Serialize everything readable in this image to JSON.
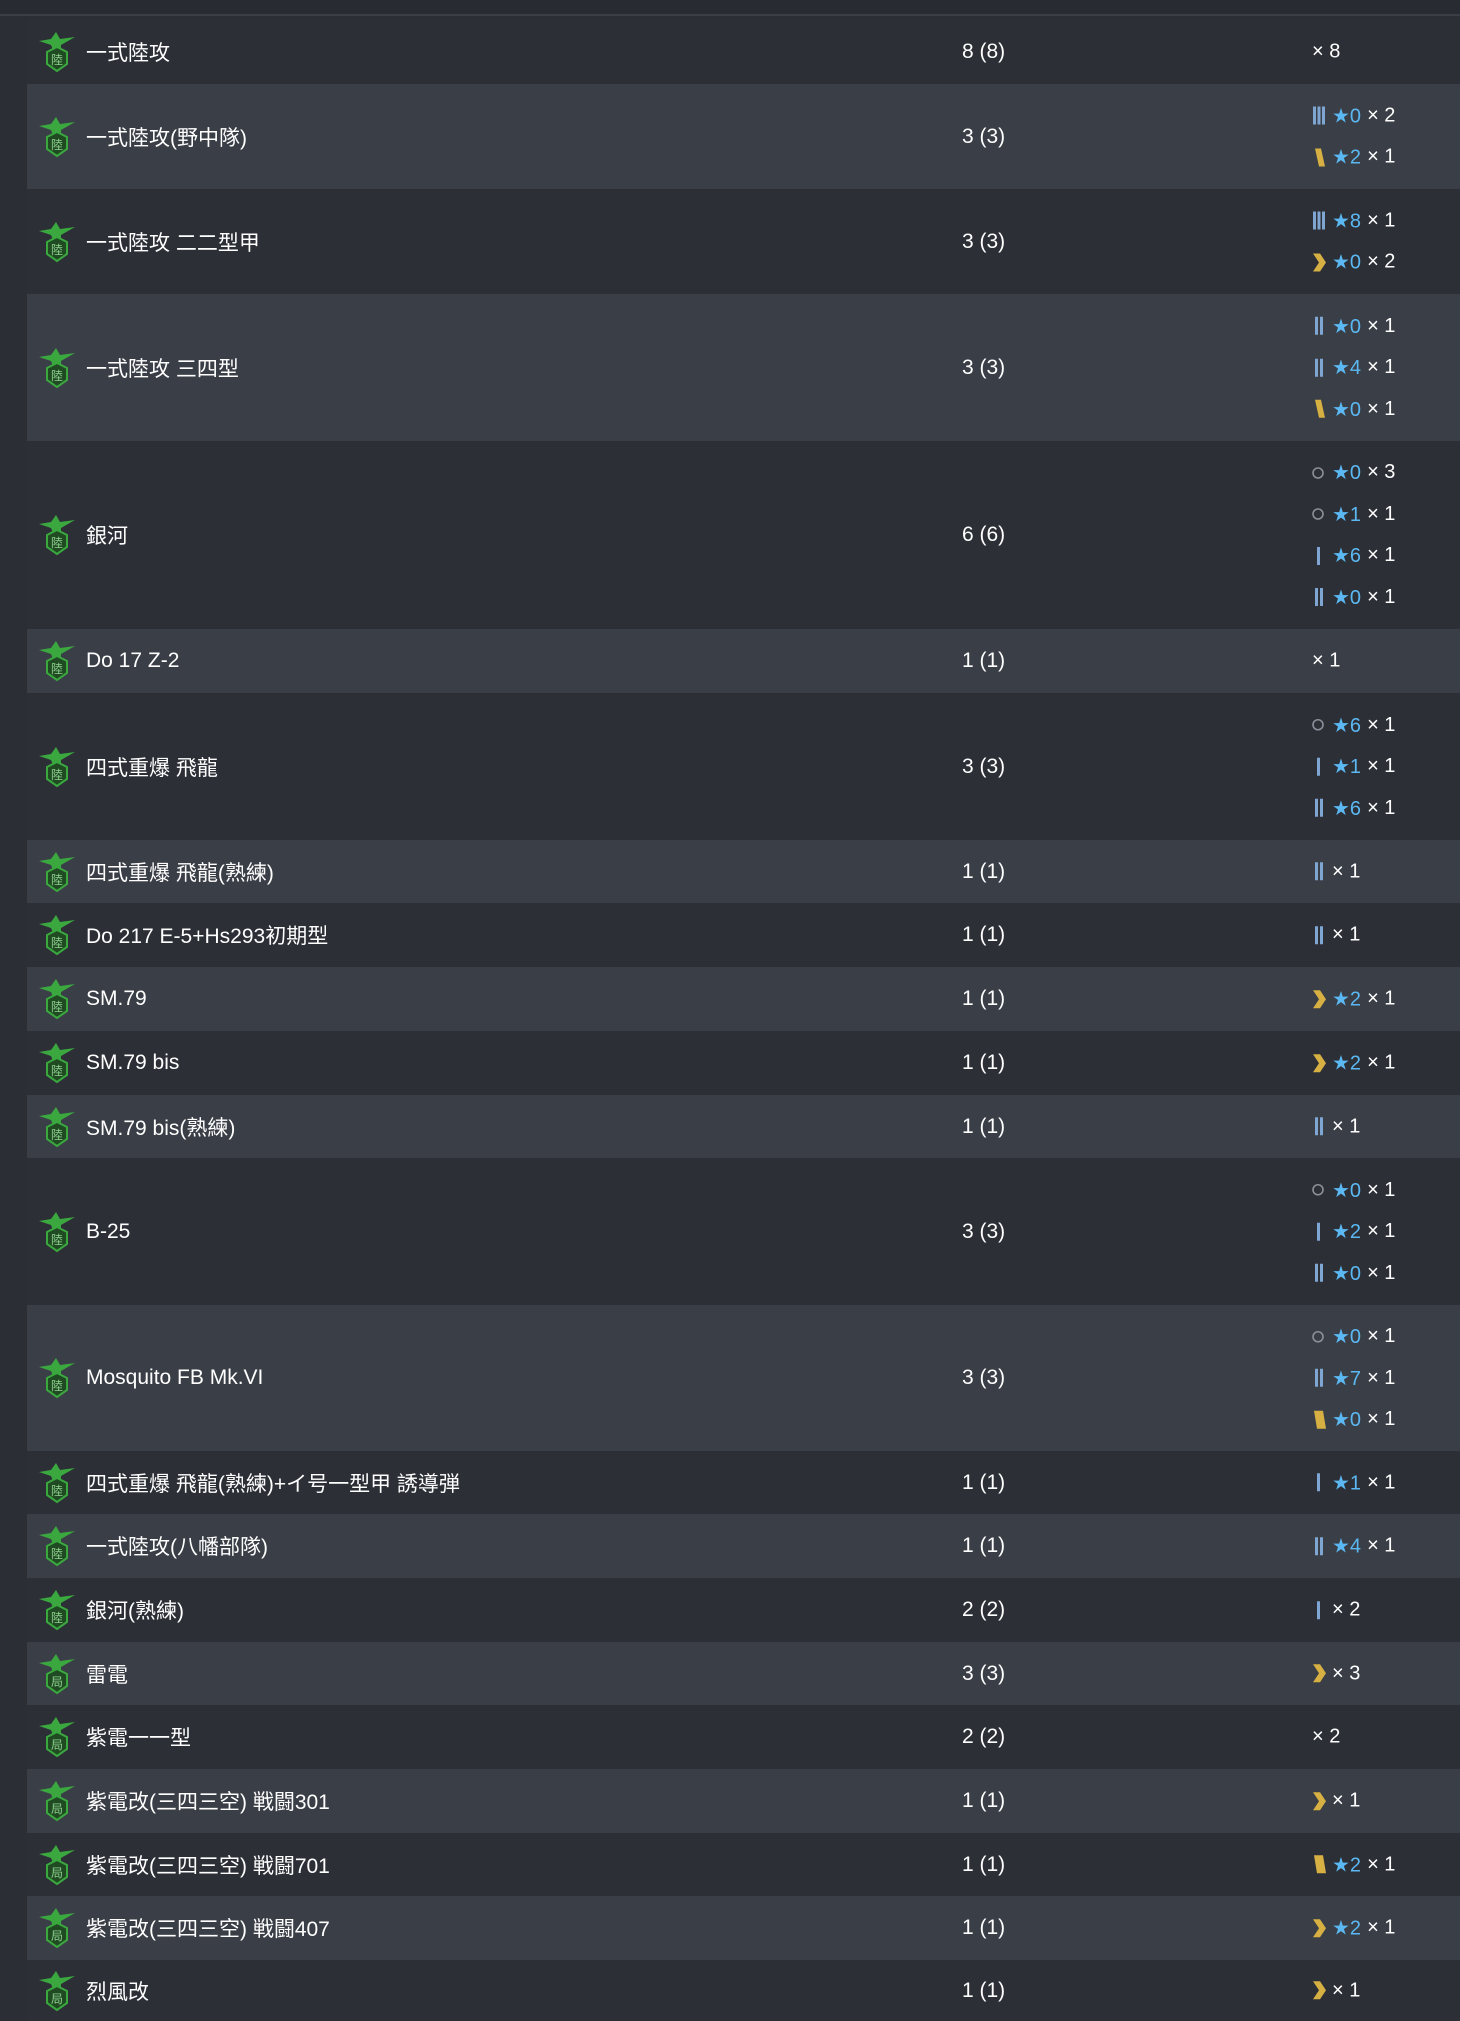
{
  "rows": [
    {
      "name": "一式陸攻",
      "count": "8 (8)",
      "icon": "land-attacker-icon",
      "prof": [
        {
          "rank": "",
          "star": "",
          "mult": "× 8"
        }
      ]
    },
    {
      "name": "一式陸攻(野中隊)",
      "count": "3 (3)",
      "icon": "land-attacker-icon",
      "prof": [
        {
          "rank": "3",
          "star": "★0",
          "mult": "× 2"
        },
        {
          "rank": "4",
          "star": "★2",
          "mult": "× 1"
        }
      ]
    },
    {
      "name": "一式陸攻 二二型甲",
      "count": "3 (3)",
      "icon": "land-attacker-icon",
      "prof": [
        {
          "rank": "3",
          "star": "★8",
          "mult": "× 1"
        },
        {
          "rank": "6",
          "star": "★0",
          "mult": "× 2"
        }
      ]
    },
    {
      "name": "一式陸攻 三四型",
      "count": "3 (3)",
      "icon": "land-attacker-icon",
      "prof": [
        {
          "rank": "2",
          "star": "★0",
          "mult": "× 1"
        },
        {
          "rank": "2",
          "star": "★4",
          "mult": "× 1"
        },
        {
          "rank": "4",
          "star": "★0",
          "mult": "× 1"
        }
      ]
    },
    {
      "name": "銀河",
      "count": "6 (6)",
      "icon": "land-attacker-icon",
      "prof": [
        {
          "rank": "0",
          "star": "★0",
          "mult": "× 3"
        },
        {
          "rank": "0",
          "star": "★1",
          "mult": "× 1"
        },
        {
          "rank": "1",
          "star": "★6",
          "mult": "× 1"
        },
        {
          "rank": "2",
          "star": "★0",
          "mult": "× 1"
        }
      ]
    },
    {
      "name": "Do 17 Z-2",
      "count": "1 (1)",
      "icon": "land-attacker-icon",
      "prof": [
        {
          "rank": "",
          "star": "",
          "mult": "× 1"
        }
      ]
    },
    {
      "name": "四式重爆 飛龍",
      "count": "3 (3)",
      "icon": "land-attacker-icon",
      "prof": [
        {
          "rank": "0",
          "star": "★6",
          "mult": "× 1"
        },
        {
          "rank": "1",
          "star": "★1",
          "mult": "× 1"
        },
        {
          "rank": "2",
          "star": "★6",
          "mult": "× 1"
        }
      ]
    },
    {
      "name": "四式重爆 飛龍(熟練)",
      "count": "1 (1)",
      "icon": "land-attacker-icon",
      "prof": [
        {
          "rank": "2",
          "star": "",
          "mult": "× 1"
        }
      ]
    },
    {
      "name": "Do 217 E-5+Hs293初期型",
      "count": "1 (1)",
      "icon": "land-attacker-icon",
      "prof": [
        {
          "rank": "2",
          "star": "",
          "mult": "× 1"
        }
      ]
    },
    {
      "name": "SM.79",
      "count": "1 (1)",
      "icon": "land-attacker-icon",
      "prof": [
        {
          "rank": "6",
          "star": "★2",
          "mult": "× 1"
        }
      ]
    },
    {
      "name": "SM.79 bis",
      "count": "1 (1)",
      "icon": "land-attacker-icon",
      "prof": [
        {
          "rank": "6",
          "star": "★2",
          "mult": "× 1"
        }
      ]
    },
    {
      "name": "SM.79 bis(熟練)",
      "count": "1 (1)",
      "icon": "land-attacker-icon",
      "prof": [
        {
          "rank": "2",
          "star": "",
          "mult": "× 1"
        }
      ]
    },
    {
      "name": "B-25",
      "count": "3 (3)",
      "icon": "land-attacker-icon",
      "prof": [
        {
          "rank": "0",
          "star": "★0",
          "mult": "× 1"
        },
        {
          "rank": "1",
          "star": "★2",
          "mult": "× 1"
        },
        {
          "rank": "2",
          "star": "★0",
          "mult": "× 1"
        }
      ]
    },
    {
      "name": "Mosquito FB Mk.VI",
      "count": "3 (3)",
      "icon": "land-attacker-icon",
      "prof": [
        {
          "rank": "0",
          "star": "★0",
          "mult": "× 1"
        },
        {
          "rank": "2",
          "star": "★7",
          "mult": "× 1"
        },
        {
          "rank": "5",
          "star": "★0",
          "mult": "× 1"
        }
      ]
    },
    {
      "name": "四式重爆 飛龍(熟練)+イ号一型甲 誘導弾",
      "count": "1 (1)",
      "icon": "land-attacker-icon",
      "prof": [
        {
          "rank": "1",
          "star": "★1",
          "mult": "× 1"
        }
      ]
    },
    {
      "name": "一式陸攻(八幡部隊)",
      "count": "1 (1)",
      "icon": "land-attacker-icon",
      "prof": [
        {
          "rank": "2",
          "star": "★4",
          "mult": "× 1"
        }
      ]
    },
    {
      "name": "銀河(熟練)",
      "count": "2 (2)",
      "icon": "land-attacker-icon",
      "prof": [
        {
          "rank": "1",
          "star": "",
          "mult": "× 2"
        }
      ]
    },
    {
      "name": "雷電",
      "count": "3 (3)",
      "icon": "interceptor-icon",
      "prof": [
        {
          "rank": "6",
          "star": "",
          "mult": "× 3"
        }
      ]
    },
    {
      "name": "紫電一一型",
      "count": "2 (2)",
      "icon": "interceptor-icon",
      "prof": [
        {
          "rank": "",
          "star": "",
          "mult": "× 2"
        }
      ]
    },
    {
      "name": "紫電改(三四三空) 戦闘301",
      "count": "1 (1)",
      "icon": "interceptor-icon",
      "prof": [
        {
          "rank": "6",
          "star": "",
          "mult": "× 1"
        }
      ]
    },
    {
      "name": "紫電改(三四三空) 戦闘701",
      "count": "1 (1)",
      "icon": "interceptor-icon",
      "prof": [
        {
          "rank": "5",
          "star": "★2",
          "mult": "× 1"
        }
      ]
    },
    {
      "name": "紫電改(三四三空) 戦闘407",
      "count": "1 (1)",
      "icon": "interceptor-icon",
      "prof": [
        {
          "rank": "6",
          "star": "★2",
          "mult": "× 1"
        }
      ]
    },
    {
      "name": "烈風改",
      "count": "1 (1)",
      "icon": "interceptor-icon",
      "prof": [
        {
          "rank": "6",
          "star": "",
          "mult": "× 1"
        }
      ]
    }
  ],
  "colors": {
    "row_odd": "#2c2f36",
    "row_even": "#3a3e46",
    "star": "#5bb8f2",
    "rank_blue": "#7fa6d2",
    "rank_gold": "#d6b043",
    "icon_green": "#3aa83f"
  },
  "icon_glyphs": {
    "land-attacker-icon": "陸",
    "interceptor-icon": "局"
  }
}
